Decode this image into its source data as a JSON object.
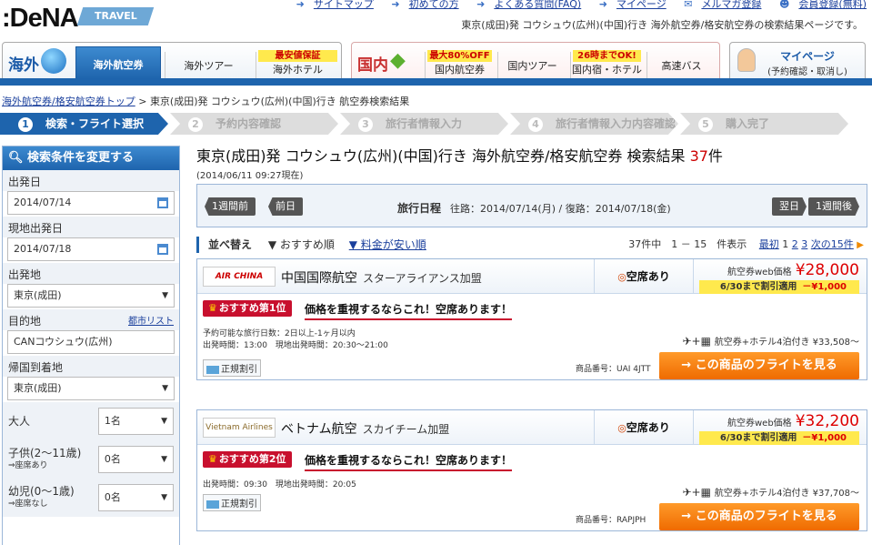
{
  "header": {
    "logo": ":DeNA",
    "travel": "TRAVEL",
    "links": [
      {
        "icon": "arrow-icon",
        "label": "サイトマップ"
      },
      {
        "icon": "arrow-icon",
        "label": "初めての方"
      },
      {
        "icon": "arrow-icon",
        "label": "よくある質問(FAQ)"
      },
      {
        "icon": "arrow-icon",
        "label": "マイページ"
      },
      {
        "icon": "mail-icon",
        "label": "メルマガ登録"
      },
      {
        "icon": "person-icon",
        "label": "会員登録(無料)"
      }
    ],
    "tagline": "東京(成田)発 コウシュウ(広州)(中国)行き 海外航空券/格安航空券の検索結果ページです。"
  },
  "nav": {
    "intl": {
      "label": "海外",
      "tabs": [
        {
          "label": "海外航空券",
          "active": true
        },
        {
          "label": "海外ツアー"
        },
        {
          "label": "海外ホテル",
          "badge": "最安値保証"
        }
      ]
    },
    "dom": {
      "label": "国内",
      "tabs": [
        {
          "label": "国内航空券",
          "badge": "最大80%OFF"
        },
        {
          "label": "国内ツアー"
        },
        {
          "label": "国内宿・ホテル",
          "badge": "26時までOK!"
        },
        {
          "label": "高速バス"
        }
      ]
    },
    "mypage": {
      "title": "マイページ",
      "sub": "(予約確認・取消し)"
    }
  },
  "breadcrumb": {
    "link": "海外航空券/格安航空券トップ",
    "sep": ">",
    "current": "東京(成田)発 コウシュウ(広州)(中国)行き 航空券検索結果"
  },
  "steps": [
    {
      "n": "1",
      "label": "検索・フライト選択"
    },
    {
      "n": "2",
      "label": "予約内容確認"
    },
    {
      "n": "3",
      "label": "旅行者情報入力"
    },
    {
      "n": "4",
      "label": "旅行者情報入力内容確認"
    },
    {
      "n": "5",
      "label": "購入完了"
    }
  ],
  "sidebar": {
    "title": "検索条件を変更する",
    "dep_date_label": "出発日",
    "dep_date": "2014/07/14",
    "ret_date_label": "現地出発日",
    "ret_date": "2014/07/18",
    "origin_label": "出発地",
    "origin": "東京(成田)",
    "dest_label": "目的地",
    "city_list": "都市リスト",
    "dest": "CANコウシュウ(広州)",
    "return_label": "帰国到着地",
    "return": "東京(成田)",
    "adult_label": "大人",
    "adult": "1名",
    "child_label": "子供(2～11歳)",
    "child_sub": "⇒座席あり",
    "child": "0名",
    "infant_label": "幼児(0～1歳)",
    "infant_sub": "⇒座席なし",
    "infant": "0名"
  },
  "results": {
    "title_pre": "東京(成田)発 コウシュウ(広州)(中国)行き 海外航空券/格安航空券 検索結果 ",
    "count": "37",
    "title_suf": "件",
    "as_of": "(2014/06/11 09:27現在)",
    "prev_week": "1週間前",
    "prev_day": "前日",
    "next_day": "翌日",
    "next_week": "1週間後",
    "itin_label": "旅行日程",
    "itin": "往路：2014/07/14(月) / 復路：2014/07/18(金)",
    "sort_label": "並べ替え",
    "sort_rec": "▼ おすすめ順",
    "sort_price": "▼ 料金が安い順",
    "pager": {
      "summary": "37件中　1 － 15　件表示",
      "first": "最初",
      "p1": "1",
      "p2": "2",
      "p3": "3",
      "next": "次の15件"
    },
    "items": [
      {
        "logo": "AIR CHINA",
        "airline": "中国国際航空",
        "alliance": "スターアライアンス加盟",
        "seat": "空席あり",
        "price_label": "航空券web価格",
        "price": "¥28,000",
        "disc_label": "6/30まで割引適用",
        "disc": "－¥1,000",
        "rank": "おすすめ第1位",
        "catch": "価格を重視するならこれ！空席あります！",
        "info1": "予約可能な旅行日数：2日以上-1ヶ月以内",
        "info2": "出発時間：13:00　現地出発時間：20:30～21:00",
        "fare": "正規割引",
        "pkg": "航空券+ホテル4泊付き ¥33,508～",
        "code": "商品番号：UAI 4JTT",
        "cta": "→ この商品のフライトを見る"
      },
      {
        "logo": "Vietnam Airlines",
        "airline": "ベトナム航空",
        "alliance": "スカイチーム加盟",
        "seat": "空席あり",
        "price_label": "航空券web価格",
        "price": "¥32,200",
        "disc_label": "6/30まで割引適用",
        "disc": "－¥1,000",
        "rank": "おすすめ第2位",
        "catch": "価格を重視するならこれ！空席あります！",
        "info1": "出発時間：09:30　現地出発時間：20:05",
        "info2": "",
        "fare": "正規割引",
        "pkg": "航空券+ホテル4泊付き ¥37,708～",
        "code": "商品番号：RAPJPH",
        "cta": "→ この商品のフライトを見る"
      }
    ]
  }
}
